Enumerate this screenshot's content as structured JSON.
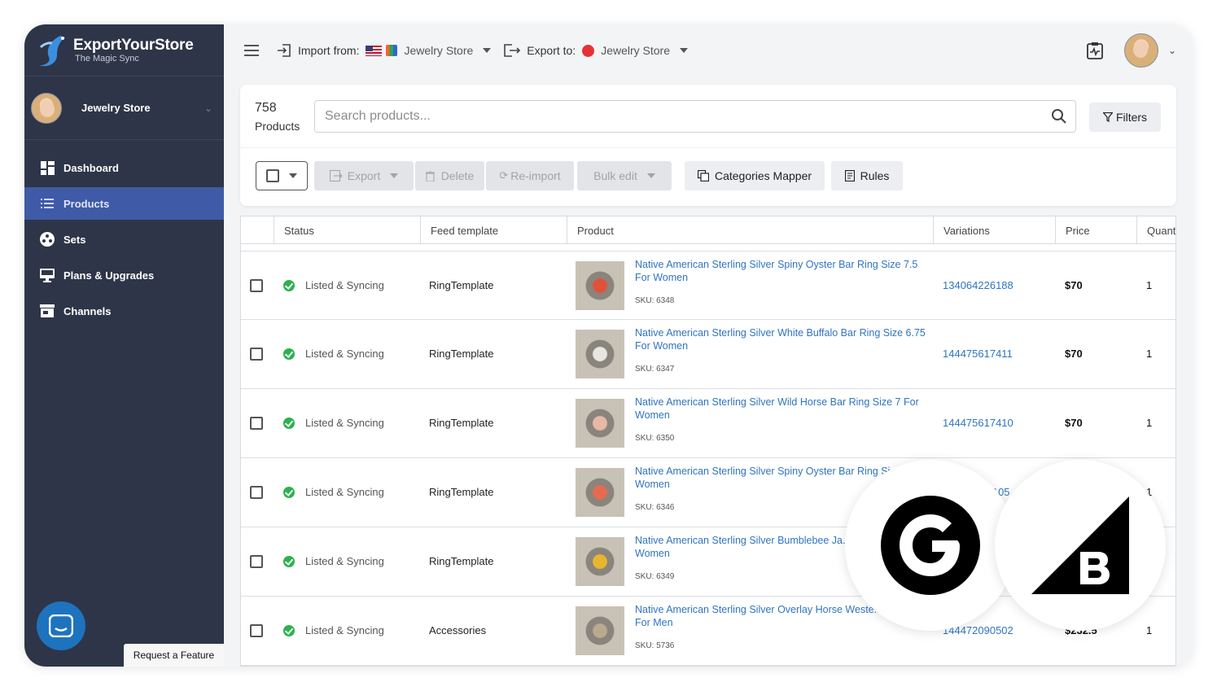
{
  "brand": {
    "name": "ExportYourStore",
    "tagline": "The Magic Sync"
  },
  "sidebar": {
    "store_name": "Jewelry Store",
    "items": [
      {
        "label": "Dashboard",
        "icon": "dashboard-icon"
      },
      {
        "label": "Products",
        "icon": "list-icon",
        "active": true
      },
      {
        "label": "Sets",
        "icon": "sets-icon"
      },
      {
        "label": "Plans & Upgrades",
        "icon": "monitor-icon"
      },
      {
        "label": "Channels",
        "icon": "store-icon"
      }
    ],
    "request_feature": "Request a Feature"
  },
  "topbar": {
    "import_label": "Import from:",
    "import_store": "Jewelry Store",
    "export_label": "Export to:",
    "export_store": "Jewelry Store"
  },
  "products_header": {
    "count": "758",
    "count_label": "Products",
    "search_placeholder": "Search products...",
    "filters_label": "Filters"
  },
  "toolbar": {
    "export": "Export",
    "delete": "Delete",
    "reimport": "Re-import",
    "bulk_edit": "Bulk edit",
    "categories_mapper": "Categories Mapper",
    "rules": "Rules"
  },
  "table": {
    "columns": [
      "Status",
      "Feed template",
      "Product",
      "Variations",
      "Price",
      "Quant"
    ],
    "rows": [
      {
        "status": "Listed & Syncing",
        "template": "RingTemplate",
        "title": "Native American Sterling Silver Spiny Oyster Bar Ring Size 7.5 For Women",
        "sku": "SKU: 6348",
        "variations": "134064226188",
        "price": "$70",
        "qty": "1",
        "stone": "#e0533a"
      },
      {
        "status": "Listed & Syncing",
        "template": "RingTemplate",
        "title": "Native American Sterling Silver White Buffalo Bar Ring Size 6.75 For Women",
        "sku": "SKU: 6347",
        "variations": "144475617411",
        "price": "$70",
        "qty": "1",
        "stone": "#e8e6e1"
      },
      {
        "status": "Listed & Syncing",
        "template": "RingTemplate",
        "title": "Native American Sterling Silver Wild Horse Bar Ring Size 7 For Women",
        "sku": "SKU: 6350",
        "variations": "144475617410",
        "price": "$70",
        "qty": "1",
        "stone": "#e7b8a6"
      },
      {
        "status": "Listed & Syncing",
        "template": "RingTemplate",
        "title": "Native American Sterling Silver Spiny Oyster Bar Ring Si... For Women",
        "sku": "SKU: 6346",
        "variations": "...105",
        "price": "",
        "qty": "1",
        "stone": "#e56a4f"
      },
      {
        "status": "Listed & Syncing",
        "template": "RingTemplate",
        "title": "Native American Sterling Silver Bumblebee Ja... Size 7 For Women",
        "sku": "SKU: 6349",
        "variations": "",
        "price": "",
        "qty": "",
        "stone": "#e7b631"
      },
      {
        "status": "Listed & Syncing",
        "template": "Accessories",
        "title": "Native American Sterling Silver Overlay Horse Weste... Buckle For Men",
        "sku": "SKU: 5736",
        "variations": "144472090502",
        "price": "$232.5",
        "qty": "1",
        "stone": "#b9a98e"
      }
    ]
  }
}
